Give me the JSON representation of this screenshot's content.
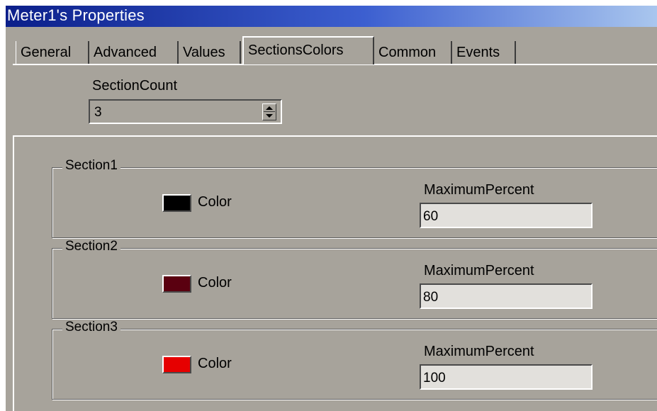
{
  "window": {
    "title": "Meter1's Properties"
  },
  "tabs": [
    {
      "label": "General"
    },
    {
      "label": "Advanced"
    },
    {
      "label": "Values"
    },
    {
      "label": "SectionsColors",
      "active": true
    },
    {
      "label": "Common"
    },
    {
      "label": "Events"
    }
  ],
  "section_count": {
    "label": "SectionCount",
    "value": "3"
  },
  "sections": [
    {
      "title": "Section1",
      "color_label": "Color",
      "color": "#000000",
      "max_label": "MaximumPercent",
      "max_value": "60"
    },
    {
      "title": "Section2",
      "color_label": "Color",
      "color": "#5a0010",
      "max_label": "MaximumPercent",
      "max_value": "80"
    },
    {
      "title": "Section3",
      "color_label": "Color",
      "color": "#e60000",
      "max_label": "MaximumPercent",
      "max_value": "100"
    }
  ]
}
